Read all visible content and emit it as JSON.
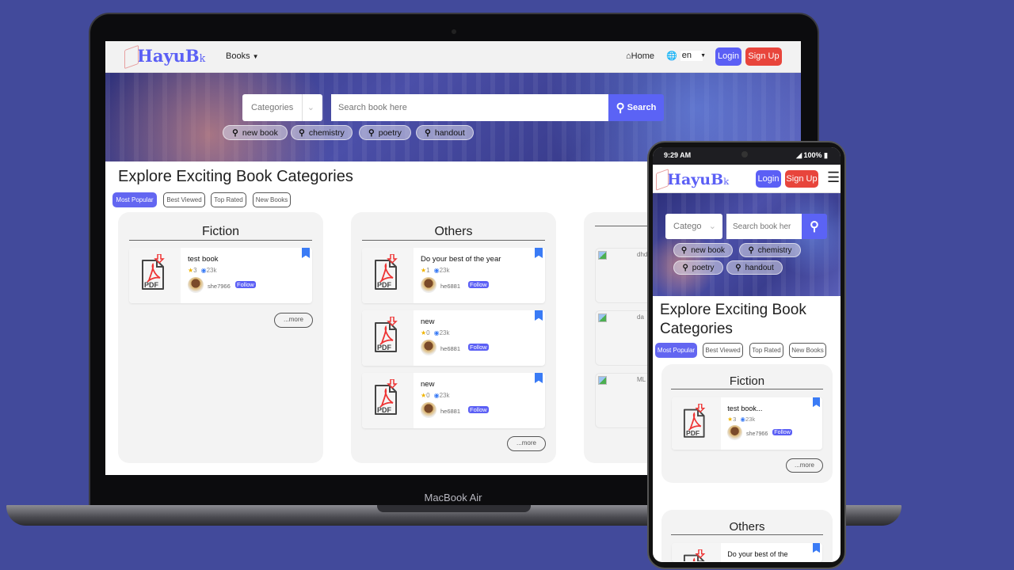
{
  "device_labels": {
    "laptop": "MacBook Air"
  },
  "colors": {
    "background": "#424a9b",
    "accent": "#5b5ff5",
    "signup": "#e8453c",
    "bookmark": "#3a7bf5",
    "star": "#f0b400"
  },
  "brand": {
    "logo": "HayuB",
    "logo_suffix": "k"
  },
  "nav": {
    "books": "Books",
    "books_icon": "chevron-down-icon",
    "home": "Home",
    "home_icon": "home-icon",
    "lang_icon": "globe-icon",
    "lang": "en",
    "login": "Login",
    "signup": "Sign Up",
    "menu_icon": "hamburger-icon"
  },
  "search": {
    "category_placeholder": "Categories",
    "category_placeholder_mobile": "Catego",
    "placeholder": "Search book here",
    "placeholder_mobile": "Search book her",
    "button": "Search",
    "tags": [
      "new book",
      "chemistry",
      "poetry",
      "handout"
    ]
  },
  "main": {
    "title": "Explore Exciting Book Categories",
    "title_mobile_line1": "Explore Exciting Book",
    "title_mobile_line2": "Categories",
    "tabs": [
      {
        "label": "Most Popular",
        "active": true
      },
      {
        "label": "Best Viewed",
        "active": false
      },
      {
        "label": "Top Rated",
        "active": false
      },
      {
        "label": "New Books",
        "active": false
      }
    ],
    "more": "...more"
  },
  "pdf_label": "PDF",
  "categories": [
    {
      "name": "Fiction",
      "books": [
        {
          "title": "test book",
          "title_mobile": "test book...",
          "rating": "3",
          "views": "23k",
          "user": "she7966",
          "follow": "Follow"
        }
      ]
    },
    {
      "name": "Others",
      "books": [
        {
          "title": "Do your best of the year",
          "title_mobile": "Do your best of the",
          "rating": "1",
          "views": "23k",
          "user": "he6881",
          "follow": "Follow"
        },
        {
          "title": "new",
          "rating": "0",
          "views": "23k",
          "user": "he6881",
          "follow": "Follow"
        },
        {
          "title": "new",
          "rating": "0",
          "views": "23k",
          "user": "he6881",
          "follow": "Follow"
        }
      ]
    },
    {
      "name": "",
      "books": [
        {
          "alt": "dhd"
        },
        {
          "alt": "da"
        },
        {
          "alt": "ML"
        }
      ]
    }
  ],
  "phone_status": {
    "time": "9:29 AM",
    "battery": "100%"
  }
}
